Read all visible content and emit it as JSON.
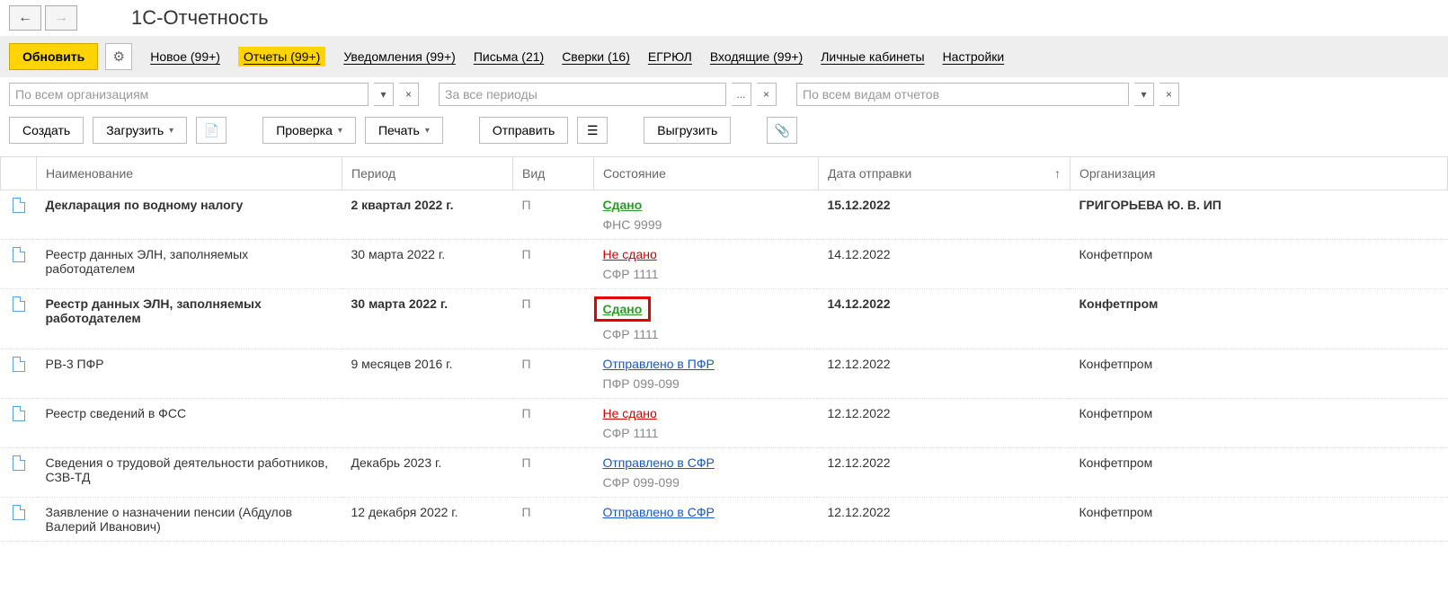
{
  "page_title": "1С-Отчетность",
  "nav": {
    "back": "←",
    "forward": "→"
  },
  "toolbar": {
    "refresh": "Обновить",
    "gear": "⚙",
    "tabs": {
      "new": "Новое (99+)",
      "reports": "Отчеты (99+)",
      "notifications": "Уведомления (99+)",
      "letters": "Письма (21)",
      "reconciliations": "Сверки (16)",
      "egrul": "ЕГРЮЛ",
      "incoming": "Входящие (99+)",
      "cabinets": "Личные кабинеты",
      "settings": "Настройки"
    }
  },
  "filters": {
    "org_placeholder": "По всем организациям",
    "period_placeholder": "За все периоды",
    "type_placeholder": "По всем видам отчетов",
    "dropdown": "▾",
    "ellipsis": "...",
    "clear": "×"
  },
  "actions": {
    "create": "Создать",
    "load": "Загрузить",
    "file": "📄",
    "check": "Проверка",
    "print": "Печать",
    "send": "Отправить",
    "list": "☰",
    "export": "Выгрузить",
    "attach": "📎"
  },
  "columns": {
    "name": "Наименование",
    "period": "Период",
    "kind": "Вид",
    "status": "Состояние",
    "sent": "Дата отправки",
    "sort": "↑",
    "org": "Организация"
  },
  "rows": [
    {
      "bold": true,
      "name": "Декларация по водному налогу",
      "period": "2 квартал 2022 г.",
      "kind": "П",
      "status_text": "Сдано",
      "status_class": "status-green",
      "sub": "ФНС 9999",
      "date": "15.12.2022",
      "org": "ГРИГОРЬЕВА Ю. В. ИП",
      "highlight": false
    },
    {
      "bold": false,
      "name": "Реестр данных ЭЛН, заполняемых работодателем",
      "period": "30 марта 2022 г.",
      "kind": "П",
      "status_text": "Не сдано",
      "status_class": "status-red",
      "sub": "СФР 1111",
      "date": "14.12.2022",
      "org": "Конфетпром",
      "highlight": false
    },
    {
      "bold": true,
      "name": "Реестр данных ЭЛН, заполняемых работодателем",
      "period": "30 марта 2022 г.",
      "kind": "П",
      "status_text": "Сдано",
      "status_class": "status-green",
      "sub": "СФР 1111",
      "date": "14.12.2022",
      "org": "Конфетпром",
      "highlight": true
    },
    {
      "bold": false,
      "name": "РВ-3 ПФР",
      "period": "9 месяцев 2016 г.",
      "kind": "П",
      "status_text": "Отправлено в ПФР",
      "status_class": "status-blue",
      "sub": "ПФР 099-099",
      "date": "12.12.2022",
      "org": "Конфетпром",
      "highlight": false
    },
    {
      "bold": false,
      "name": "Реестр сведений в ФСС",
      "period": "",
      "kind": "П",
      "status_text": "Не сдано",
      "status_class": "status-red",
      "sub": "СФР 1111",
      "date": "12.12.2022",
      "org": "Конфетпром",
      "highlight": false
    },
    {
      "bold": false,
      "name": "Сведения о трудовой деятельности работников, СЗВ-ТД",
      "period": "Декабрь 2023 г.",
      "kind": "П",
      "status_text": "Отправлено в СФР",
      "status_class": "status-blue",
      "sub": "СФР 099-099",
      "date": "12.12.2022",
      "org": "Конфетпром",
      "highlight": false
    },
    {
      "bold": false,
      "name": "Заявление о назначении пенсии (Абдулов Валерий Иванович)",
      "period": "12 декабря 2022 г.",
      "kind": "П",
      "status_text": "Отправлено в СФР",
      "status_class": "status-blue",
      "sub": "",
      "date": "12.12.2022",
      "org": "Конфетпром",
      "highlight": false
    }
  ]
}
